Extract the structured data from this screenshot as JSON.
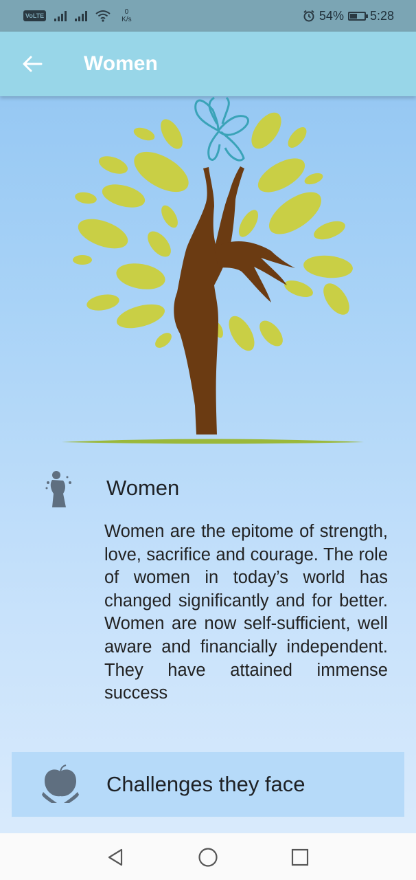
{
  "status_bar": {
    "network_badge": "VoLTE",
    "speed_value": "0",
    "speed_unit": "K/s",
    "battery": "54%",
    "battery_level": 0.54,
    "time": "5:28",
    "icons": [
      "signal-icon",
      "signal-icon",
      "wifi-icon",
      "alarm-icon",
      "battery-icon"
    ]
  },
  "app_bar": {
    "title": "Women",
    "back_icon": "arrow-left-icon"
  },
  "hero": {
    "illustration": "woman-tree-butterfly-illustration",
    "colors": {
      "leaf": "#c9cf45",
      "trunk": "#6b3b12",
      "butterfly": "#3aa3b8",
      "ground": "#9ab83a"
    }
  },
  "sections": [
    {
      "icon": "woman-silhouette-icon",
      "title": "Women",
      "text": "Women are the epitome of strength, love, sacrifice and courage. The role of women in today’s world has changed significantly and for better. Women are now self-sufficient, well aware and financially independent. They have attained immense success"
    },
    {
      "icon": "hands-holding-apple-icon",
      "title": "Challenges they face"
    }
  ],
  "nav_bar": {
    "icons": [
      "back-triangle-icon",
      "home-circle-icon",
      "recents-square-icon"
    ]
  }
}
